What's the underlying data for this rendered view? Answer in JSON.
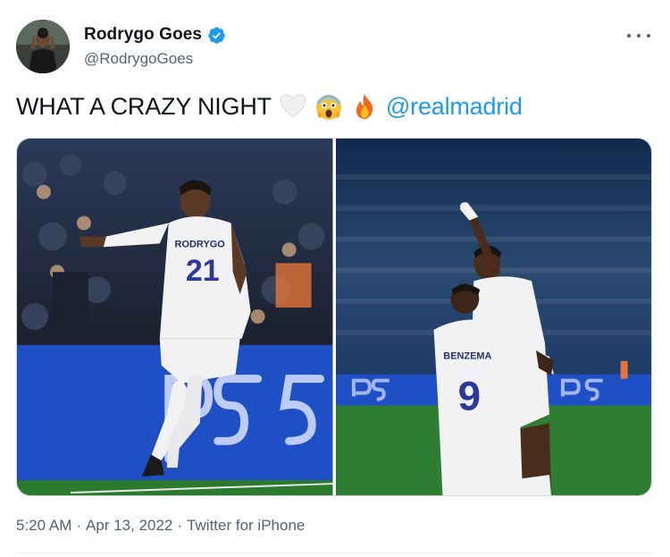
{
  "author": {
    "display_name": "Rodrygo Goes",
    "handle": "@RodrygoGoes",
    "verified": true
  },
  "tweet": {
    "text": "WHAT A CRAZY NIGHT",
    "emojis": [
      "white-heart",
      "face-screaming-in-fear",
      "fire"
    ],
    "mention": "@realmadrid"
  },
  "media": {
    "photo_1": {
      "jersey_name": "RODRYGO",
      "jersey_number": "21",
      "board_text": "PS5"
    },
    "photo_2": {
      "jersey_name": "BENZEMA",
      "jersey_number": "9",
      "board_text": "PS5"
    }
  },
  "meta": {
    "time": "5:20 AM",
    "separator": "·",
    "date": "Apr 13, 2022",
    "source": "Twitter for iPhone"
  },
  "colors": {
    "link": "#1d9bf0",
    "verified": "#1d9bf0",
    "secondary_text": "#536471",
    "board_blue": "#1f4fc4"
  },
  "icons": [
    "avatar",
    "verified-badge-icon",
    "more-options-icon"
  ]
}
